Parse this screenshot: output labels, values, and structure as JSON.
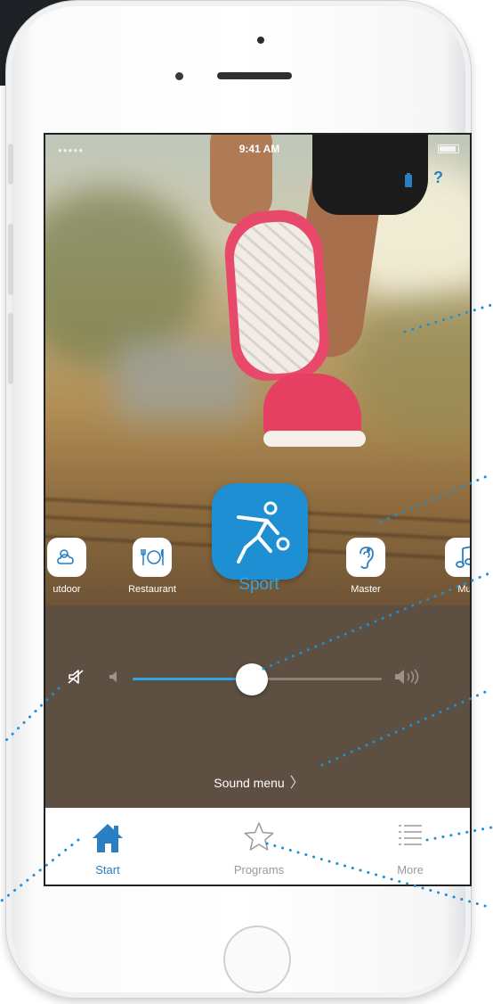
{
  "status_bar": {
    "time": "9:41 AM"
  },
  "header": {
    "help_label": "?"
  },
  "programs": {
    "items": [
      {
        "label": "utdoor",
        "icon": "weather-icon"
      },
      {
        "label": "Restaurant",
        "icon": "cutlery-icon"
      },
      {
        "label": "Sport",
        "icon": "soccer-player-icon",
        "selected": true
      },
      {
        "label": "Master",
        "icon": "ear-icon"
      },
      {
        "label": "Mu",
        "icon": "music-note-icon"
      }
    ]
  },
  "volume": {
    "level": 0.48,
    "mute_icon": "speaker-muted-icon",
    "low_icon": "volume-low-icon",
    "high_icon": "volume-high-icon"
  },
  "sound_menu": {
    "label": "Sound menu",
    "chevron": "〉"
  },
  "tab_bar": {
    "active": "Start",
    "tabs": [
      {
        "label": "Start",
        "icon": "home-icon"
      },
      {
        "label": "Programs",
        "icon": "star-icon"
      },
      {
        "label": "More",
        "icon": "list-icon"
      }
    ]
  },
  "colors": {
    "accent": "#2a7fc2",
    "sport_tile": "#1e8fd2",
    "panel": "#5d4f41",
    "callout": "#1e8fd2"
  }
}
